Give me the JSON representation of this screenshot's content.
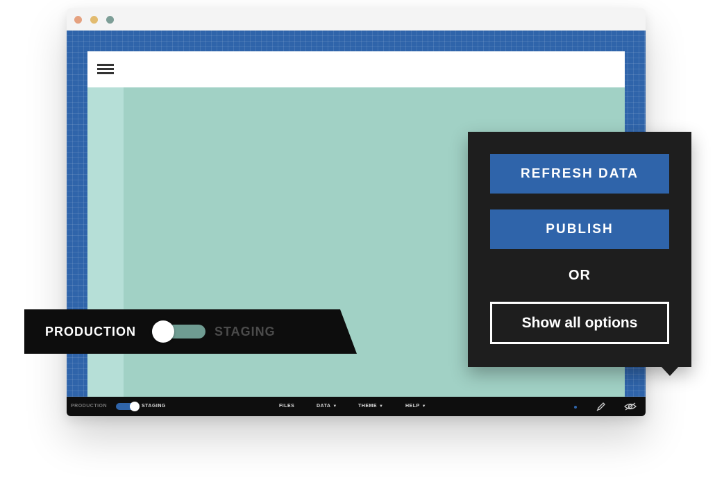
{
  "window": {
    "controls": [
      "close-dot",
      "minimize-dot",
      "maximize-dot"
    ]
  },
  "bottom_bar": {
    "production_label": "PRODUCTION",
    "staging_label": "STAGING",
    "nav": {
      "files": "FILES",
      "data": "DATA",
      "theme": "THEME",
      "help": "HELP"
    },
    "icons": [
      "status-dot-icon",
      "pencil-icon",
      "eye-icon"
    ]
  },
  "environment_callout": {
    "production_label": "PRODUCTION",
    "staging_label": "STAGING",
    "toggle_state": "production"
  },
  "popover": {
    "refresh_label": "REFRESH DATA",
    "publish_label": "PUBLISH",
    "or_label": "OR",
    "show_all_label": "Show all options"
  },
  "colors": {
    "accent_blue": "#2f64aa",
    "canvas_teal": "#a1d1c5",
    "popover_bg": "#1e1e1e"
  }
}
